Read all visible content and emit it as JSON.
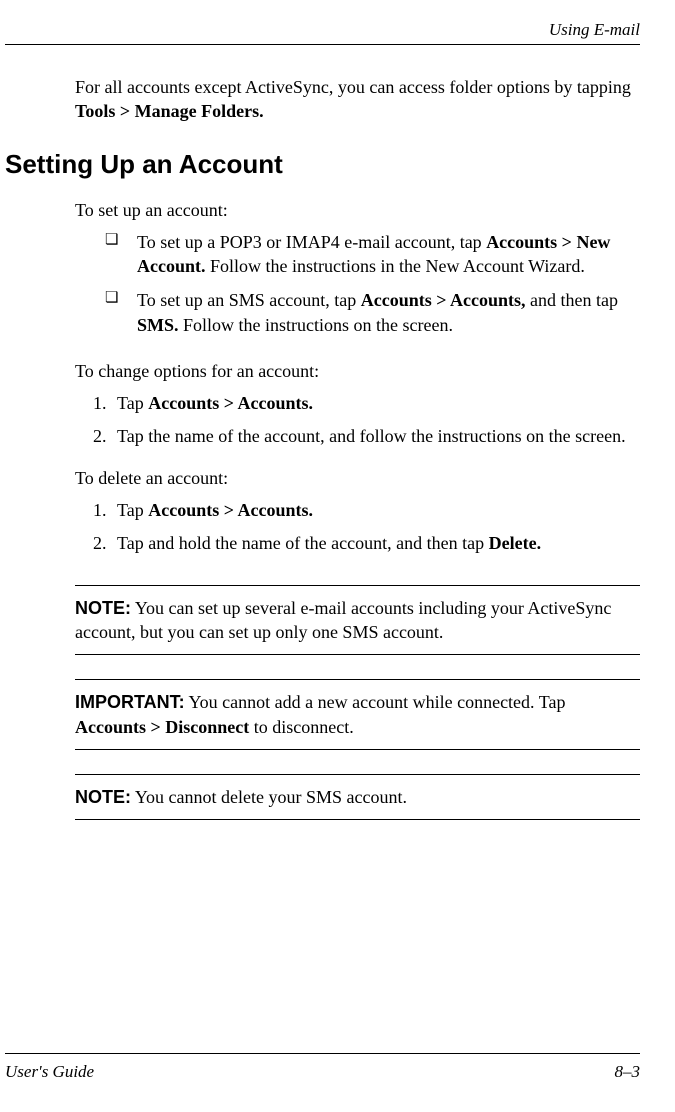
{
  "header": {
    "chapter_title": "Using E-mail"
  },
  "intro": {
    "text_before": "For all accounts except ActiveSync, you can access folder options by tapping ",
    "bold_text": "Tools > Manage Folders."
  },
  "section": {
    "heading": "Setting Up an Account",
    "setup_intro": "To set up an account:",
    "bullets": [
      {
        "pre": "To set up a POP3 or IMAP4 e-mail account, tap ",
        "bold": "Accounts > New Account.",
        "post": " Follow the instructions in the New Account Wizard."
      },
      {
        "pre": "To set up an SMS account, tap ",
        "bold1": "Accounts > Accounts,",
        "mid": " and then tap ",
        "bold2": "SMS.",
        "post": " Follow the instructions on the screen."
      }
    ],
    "change_intro": "To change options for an account:",
    "change_steps": [
      {
        "num": "1.",
        "pre": "Tap ",
        "bold": "Accounts > Accounts."
      },
      {
        "num": "2.",
        "text": "Tap the name of the account, and follow the instructions on the screen."
      }
    ],
    "delete_intro": "To delete an account:",
    "delete_steps": [
      {
        "num": "1.",
        "pre": "Tap ",
        "bold": "Accounts > Accounts."
      },
      {
        "num": "2.",
        "pre": "Tap and hold the name of the account, and then tap ",
        "bold": "Delete."
      }
    ]
  },
  "callouts": {
    "note1": {
      "label": "NOTE:",
      "text": " You can set up several e-mail accounts including your ActiveSync account, but you can set up only one SMS account."
    },
    "important": {
      "label": "IMPORTANT:",
      "pre": " You cannot add a new account while connected. Tap ",
      "bold": "Accounts > Disconnect",
      "post": " to disconnect."
    },
    "note2": {
      "label": "NOTE:",
      "text": " You cannot delete your SMS account."
    }
  },
  "footer": {
    "left": "User's Guide",
    "right": "8–3"
  }
}
